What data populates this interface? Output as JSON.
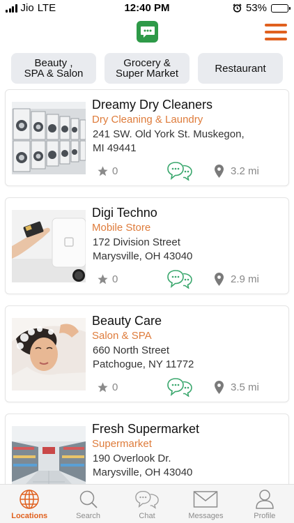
{
  "status_bar": {
    "carrier": "Jio",
    "network": "LTE",
    "time": "12:40 PM",
    "battery_percent": "53%",
    "battery_level": 0.53
  },
  "header": {
    "logo_icon": "chat-bubble-icon",
    "menu_icon": "hamburger-menu-icon"
  },
  "categories": [
    {
      "label": "Beauty ,\nSPA & Salon"
    },
    {
      "label": "Grocery &\nSuper Market"
    },
    {
      "label": "Restaurant"
    }
  ],
  "listings": [
    {
      "name": "Dreamy Dry Cleaners",
      "category": "Dry Cleaning & Laundry",
      "address_line1": "241 SW. Old York St. Muskegon,",
      "address_line2": "MI 49441",
      "rating": "0",
      "distance": "3.2 mi",
      "image": "laundromat-washing-machines"
    },
    {
      "name": "Digi Techno",
      "category": "Mobile Store",
      "address_line1": "172 Division Street",
      "address_line2": "Marysville, OH 43040",
      "rating": "0",
      "distance": "2.9 mi",
      "image": "card-payment-terminal"
    },
    {
      "name": "Beauty Care",
      "category": "Salon & SPA",
      "address_line1": "660 North Street",
      "address_line2": "Patchogue, NY 11772",
      "rating": "0",
      "distance": "3.5 mi",
      "image": "hair-wash-salon"
    },
    {
      "name": "Fresh Supermarket",
      "category": "Supermarket",
      "address_line1": "190 Overlook Dr.",
      "address_line2": "Marysville, OH 43040",
      "rating": "",
      "distance": "",
      "image": "supermarket-aisle"
    }
  ],
  "tabs": [
    {
      "label": "Locations",
      "icon": "globe-icon",
      "active": true
    },
    {
      "label": "Search",
      "icon": "search-icon",
      "active": false
    },
    {
      "label": "Chat",
      "icon": "chat-icon",
      "active": false
    },
    {
      "label": "Messages",
      "icon": "envelope-icon",
      "active": false
    },
    {
      "label": "Profile",
      "icon": "person-icon",
      "active": false
    }
  ],
  "colors": {
    "accent": "#e0601e",
    "category_text": "#de7b3a",
    "chat_green": "#3aa76d",
    "logo_green": "#2e9a48",
    "chip_bg": "#e9ebef"
  }
}
